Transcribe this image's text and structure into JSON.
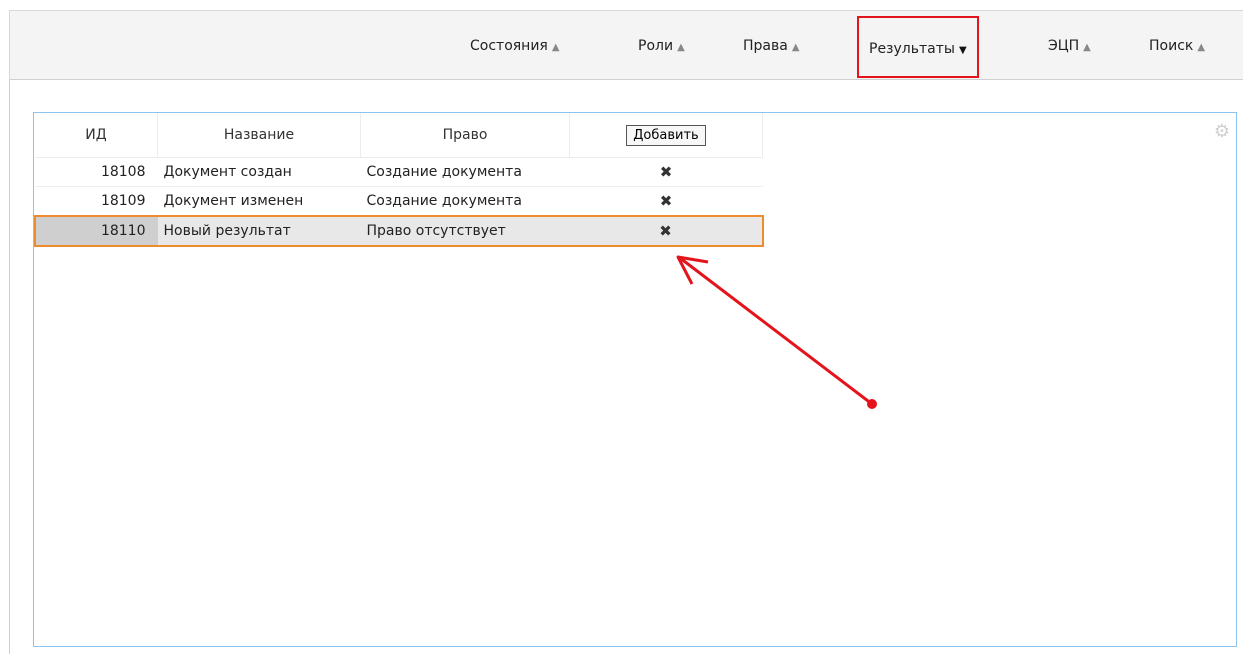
{
  "toolbar": {
    "tabs": [
      {
        "label": "Состояния",
        "state": "up"
      },
      {
        "label": "Роли",
        "state": "up"
      },
      {
        "label": "Права",
        "state": "up"
      },
      {
        "label": "Результаты",
        "state": "down"
      },
      {
        "label": "ЭЦП",
        "state": "up"
      },
      {
        "label": "Поиск",
        "state": "up"
      }
    ]
  },
  "table": {
    "headers": {
      "id": "ИД",
      "name": "Название",
      "right": "Право"
    },
    "add_label": "Добавить",
    "rows": [
      {
        "id": "18108",
        "name": "Документ создан",
        "right": "Создание документа",
        "delete": "✖"
      },
      {
        "id": "18109",
        "name": "Документ изменен",
        "right": "Создание документа",
        "delete": "✖"
      },
      {
        "id": "18110",
        "name": "Новый результат",
        "right": "Право отсутствует",
        "delete": "✖"
      }
    ],
    "selected_row_index": 2
  },
  "colors": {
    "active_tab_border": "#e3141b",
    "selected_row_border": "#ee8b2a",
    "panel_border": "#8cc4ef",
    "annotation_arrow": "#e3141b"
  },
  "icons": {
    "tab_collapsed": "chevron-up-icon",
    "tab_expanded": "chevron-down-icon",
    "settings": "gear-icon",
    "delete": "close-icon"
  }
}
